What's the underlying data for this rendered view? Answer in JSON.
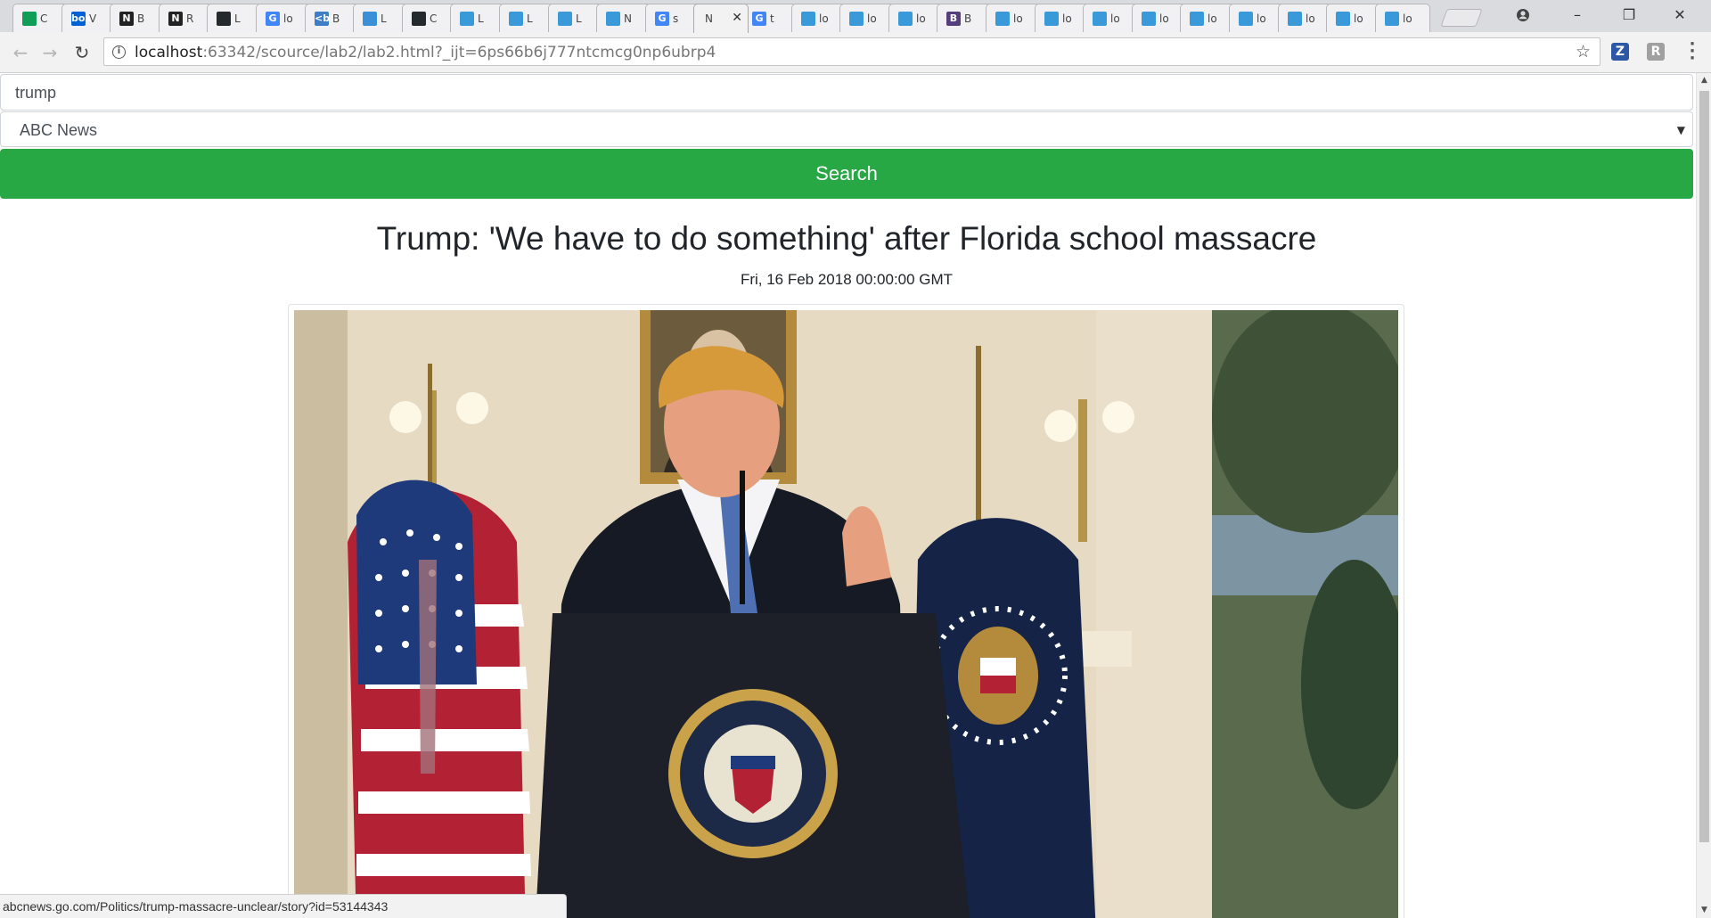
{
  "browser": {
    "tabs": [
      {
        "fav_letter": "",
        "fav_color": "#0f9d58",
        "title": "C"
      },
      {
        "fav_letter": "box",
        "fav_color": "#0061d5",
        "title": "V"
      },
      {
        "fav_letter": "N",
        "fav_color": "#222222",
        "title": "B"
      },
      {
        "fav_letter": "N",
        "fav_color": "#222222",
        "title": "R"
      },
      {
        "fav_letter": "",
        "fav_color": "#24292e",
        "title": "L"
      },
      {
        "fav_letter": "G",
        "fav_color": "#4285f4",
        "title": "lo"
      },
      {
        "fav_letter": "<b>",
        "fav_color": "#3d7ec6",
        "title": "B"
      },
      {
        "fav_letter": "",
        "fav_color": "#3a8fd6",
        "title": "L"
      },
      {
        "fav_letter": "",
        "fav_color": "#24292e",
        "title": "C"
      },
      {
        "fav_letter": "",
        "fav_color": "#3a9ad9",
        "title": "L"
      },
      {
        "fav_letter": "",
        "fav_color": "#3a9ad9",
        "title": "L"
      },
      {
        "fav_letter": "",
        "fav_color": "#3a9ad9",
        "title": "L"
      },
      {
        "fav_letter": "",
        "fav_color": "#3a9ad9",
        "title": "N"
      },
      {
        "fav_letter": "G",
        "fav_color": "#4285f4",
        "title": "s"
      },
      {
        "fav_letter": "",
        "fav_color": "",
        "title": "N"
      },
      {
        "fav_letter": "G",
        "fav_color": "#4285f4",
        "title": "t"
      },
      {
        "fav_letter": "",
        "fav_color": "#3a9ad9",
        "title": "lo"
      },
      {
        "fav_letter": "",
        "fav_color": "#3a9ad9",
        "title": "lo"
      },
      {
        "fav_letter": "",
        "fav_color": "#3a9ad9",
        "title": "lo"
      },
      {
        "fav_letter": "B",
        "fav_color": "#563d7c",
        "title": "B"
      },
      {
        "fav_letter": "",
        "fav_color": "#3a9ad9",
        "title": "lo"
      },
      {
        "fav_letter": "",
        "fav_color": "#3a9ad9",
        "title": "lo"
      },
      {
        "fav_letter": "",
        "fav_color": "#3a9ad9",
        "title": "lo"
      },
      {
        "fav_letter": "",
        "fav_color": "#3a9ad9",
        "title": "lo"
      },
      {
        "fav_letter": "",
        "fav_color": "#3a9ad9",
        "title": "lo"
      },
      {
        "fav_letter": "",
        "fav_color": "#3a9ad9",
        "title": "lo"
      },
      {
        "fav_letter": "",
        "fav_color": "#3a9ad9",
        "title": "lo"
      },
      {
        "fav_letter": "",
        "fav_color": "#3a9ad9",
        "title": "lo"
      },
      {
        "fav_letter": "",
        "fav_color": "#3a9ad9",
        "title": "lo"
      }
    ],
    "active_tab_index": 14,
    "address": {
      "host": "localhost",
      "rest": ":63342/scource/lab2/lab2.html?_ijt=6ps66b6j777ntcmcg0np6ubrp4"
    },
    "extensions": [
      {
        "label": "Z",
        "color": "#2c57a5"
      },
      {
        "label": "R",
        "color": "#9a9a9a"
      }
    ],
    "status_url": "abcnews.go.com/Politics/trump-massacre-unclear/story?id=53144343"
  },
  "form": {
    "query": "trump",
    "source": "ABC News",
    "search_label": "Search"
  },
  "article": {
    "title": "Trump: 'We have to do something' after Florida school massacre",
    "date": "Fri, 16 Feb 2018 00:00:00 GMT"
  },
  "colors": {
    "button": "#28a745",
    "tab_strip": "#dadbde",
    "toolbar": "#f2f2f2"
  }
}
